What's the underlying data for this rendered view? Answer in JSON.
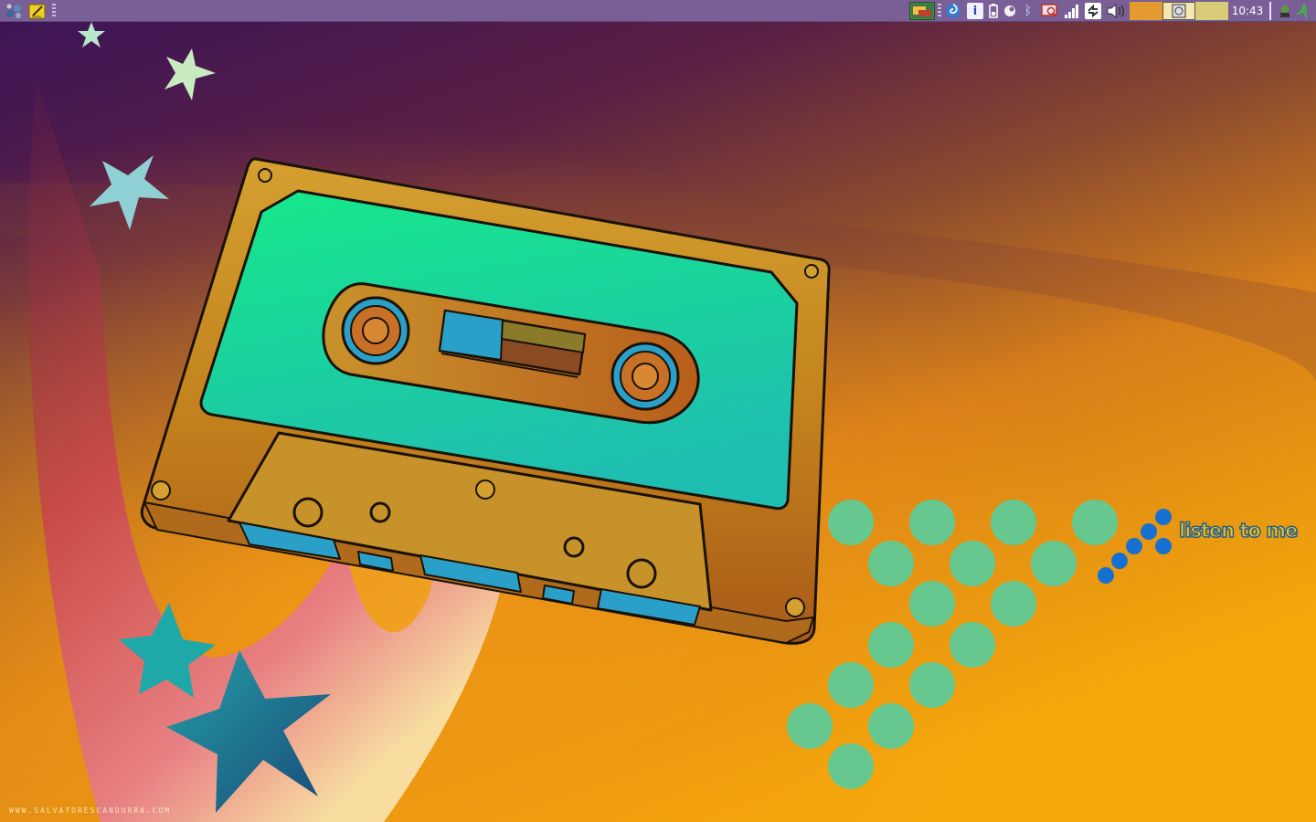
{
  "panel": {
    "left": {
      "app_menu_icon": "app-menu-icon",
      "notes_icon": "notes-icon"
    },
    "tray": {
      "icons": [
        "screenshot-icon",
        "browser-swirl-icon",
        "info-icon",
        "battery-icon",
        "network-status-icon",
        "bluetooth-icon",
        "search-monitor-icon",
        "signal-bars-icon",
        "sync-icon",
        "volume-icon"
      ],
      "workspace_count": 3
    },
    "clock": "10:43",
    "right": {
      "user_icon": "user-icon",
      "runner_icon": "runner-icon"
    }
  },
  "wallpaper": {
    "tagline": "listen to me",
    "watermark": "WWW.SALVATORESCANDURRA.COM"
  },
  "colors": {
    "panel": "#7a5f96",
    "cassette_body": "#d8a830",
    "cassette_label": "#1de08a",
    "tape_window": "#2aa0c8",
    "dots": "#66c88f",
    "blue_dots": "#1670d0"
  }
}
